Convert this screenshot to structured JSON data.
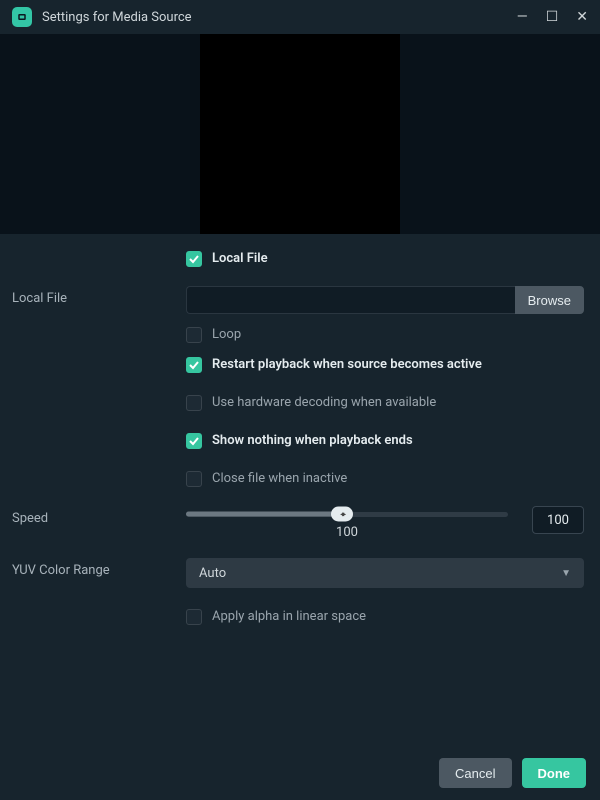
{
  "window": {
    "title": "Settings for Media Source"
  },
  "labels": {
    "local_file": "Local File",
    "speed": "Speed",
    "yuv_range": "YUV Color Range"
  },
  "checks": {
    "local_file": "Local File",
    "loop": "Loop",
    "restart": "Restart playback when source becomes active",
    "hw_decode": "Use hardware decoding when available",
    "show_nothing": "Show nothing when playback ends",
    "close_inactive": "Close file when inactive",
    "linear_alpha": "Apply alpha in linear space"
  },
  "file": {
    "value": "",
    "browse": "Browse"
  },
  "speed": {
    "display": "100",
    "input": "100"
  },
  "yuv": {
    "selected": "Auto"
  },
  "buttons": {
    "cancel": "Cancel",
    "done": "Done"
  }
}
